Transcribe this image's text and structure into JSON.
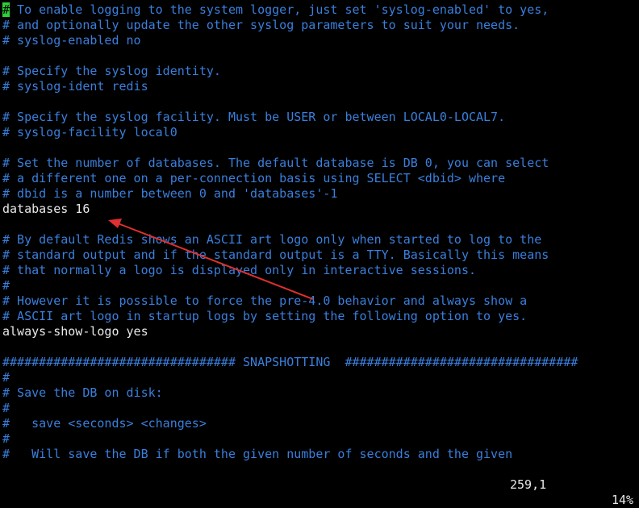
{
  "editor": {
    "lines": [
      {
        "kind": "comment",
        "rest": " To enable logging to the system logger, just set 'syslog-enabled' to yes,"
      },
      {
        "kind": "comment",
        "text": "# and optionally update the other syslog parameters to suit your needs."
      },
      {
        "kind": "comment",
        "text": "# syslog-enabled no"
      },
      {
        "kind": "blank",
        "text": ""
      },
      {
        "kind": "comment",
        "text": "# Specify the syslog identity."
      },
      {
        "kind": "comment",
        "text": "# syslog-ident redis"
      },
      {
        "kind": "blank",
        "text": ""
      },
      {
        "kind": "comment",
        "text": "# Specify the syslog facility. Must be USER or between LOCAL0-LOCAL7."
      },
      {
        "kind": "comment",
        "text": "# syslog-facility local0"
      },
      {
        "kind": "blank",
        "text": ""
      },
      {
        "kind": "comment",
        "text": "# Set the number of databases. The default database is DB 0, you can select"
      },
      {
        "kind": "comment",
        "text": "# a different one on a per-connection basis using SELECT <dbid> where"
      },
      {
        "kind": "comment",
        "text": "# dbid is a number between 0 and 'databases'-1"
      },
      {
        "kind": "code",
        "text": "databases 16"
      },
      {
        "kind": "blank",
        "text": ""
      },
      {
        "kind": "comment",
        "text": "# By default Redis shows an ASCII art logo only when started to log to the"
      },
      {
        "kind": "comment",
        "text": "# standard output and if the standard output is a TTY. Basically this means"
      },
      {
        "kind": "comment",
        "text": "# that normally a logo is displayed only in interactive sessions."
      },
      {
        "kind": "comment",
        "text": "#"
      },
      {
        "kind": "comment",
        "text": "# However it is possible to force the pre-4.0 behavior and always show a"
      },
      {
        "kind": "comment",
        "text": "# ASCII art logo in startup logs by setting the following option to yes."
      },
      {
        "kind": "code",
        "text": "always-show-logo yes"
      },
      {
        "kind": "blank",
        "text": ""
      },
      {
        "kind": "comment",
        "text": "################################ SNAPSHOTTING  ################################"
      },
      {
        "kind": "comment",
        "text": "#"
      },
      {
        "kind": "comment",
        "text": "# Save the DB on disk:"
      },
      {
        "kind": "comment",
        "text": "#"
      },
      {
        "kind": "comment",
        "text": "#   save <seconds> <changes>"
      },
      {
        "kind": "comment",
        "text": "#"
      },
      {
        "kind": "comment",
        "text": "#   Will save the DB if both the given number of seconds and the given"
      }
    ],
    "cursor_char": "#"
  },
  "statusbar": {
    "position": "259,1",
    "percent": "14%"
  },
  "colors": {
    "background": "#000000",
    "comment": "#3a7fdc",
    "code": "#e8e8e8",
    "cursor": "#2fd03a",
    "arrow": "#e03030"
  },
  "annotation": {
    "type": "arrow",
    "color": "#e03030"
  }
}
